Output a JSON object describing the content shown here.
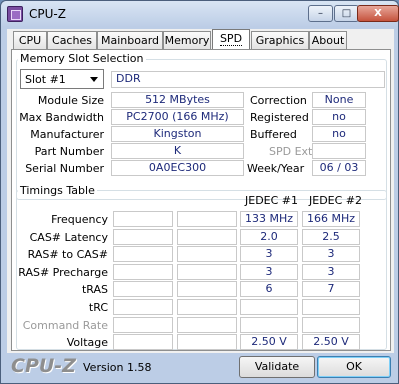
{
  "window": {
    "title": "CPU-Z",
    "controls": {
      "minimize": "–",
      "maximize": "□",
      "close": "X"
    }
  },
  "tabs": [
    "CPU",
    "Caches",
    "Mainboard",
    "Memory",
    "SPD",
    "Graphics",
    "About"
  ],
  "active_tab": "SPD",
  "memory_slot": {
    "group_title": "Memory Slot Selection",
    "slot_selected": "Slot #1",
    "type": "DDR",
    "module_size_label": "Module Size",
    "module_size": "512 MBytes",
    "max_bandwidth_label": "Max Bandwidth",
    "max_bandwidth": "PC2700 (166 MHz)",
    "manufacturer_label": "Manufacturer",
    "manufacturer": "Kingston",
    "part_number_label": "Part Number",
    "part_number": "K",
    "serial_number_label": "Serial Number",
    "serial_number": "0A0EC300",
    "correction_label": "Correction",
    "correction": "None",
    "registered_label": "Registered",
    "registered": "no",
    "buffered_label": "Buffered",
    "buffered": "no",
    "spd_ext_label": "SPD Ext.",
    "spd_ext": "",
    "week_year_label": "Week/Year",
    "week_year": "06 / 03"
  },
  "timings": {
    "group_title": "Timings Table",
    "col1_header": "JEDEC #1",
    "col2_header": "JEDEC #2",
    "rows": [
      {
        "label": "Frequency",
        "jedec1": "133 MHz",
        "jedec2": "166 MHz",
        "disabled": false
      },
      {
        "label": "CAS# Latency",
        "jedec1": "2.0",
        "jedec2": "2.5",
        "disabled": false
      },
      {
        "label": "RAS# to CAS#",
        "jedec1": "3",
        "jedec2": "3",
        "disabled": false
      },
      {
        "label": "RAS# Precharge",
        "jedec1": "3",
        "jedec2": "3",
        "disabled": false
      },
      {
        "label": "tRAS",
        "jedec1": "6",
        "jedec2": "7",
        "disabled": false
      },
      {
        "label": "tRC",
        "jedec1": "",
        "jedec2": "",
        "disabled": false
      },
      {
        "label": "Command Rate",
        "jedec1": "",
        "jedec2": "",
        "disabled": true
      },
      {
        "label": "Voltage",
        "jedec1": "2.50 V",
        "jedec2": "2.50 V",
        "disabled": false
      }
    ]
  },
  "footer": {
    "logo": "CPU-Z",
    "version": "Version 1.58",
    "validate_label": "Validate",
    "ok_label": "OK"
  }
}
